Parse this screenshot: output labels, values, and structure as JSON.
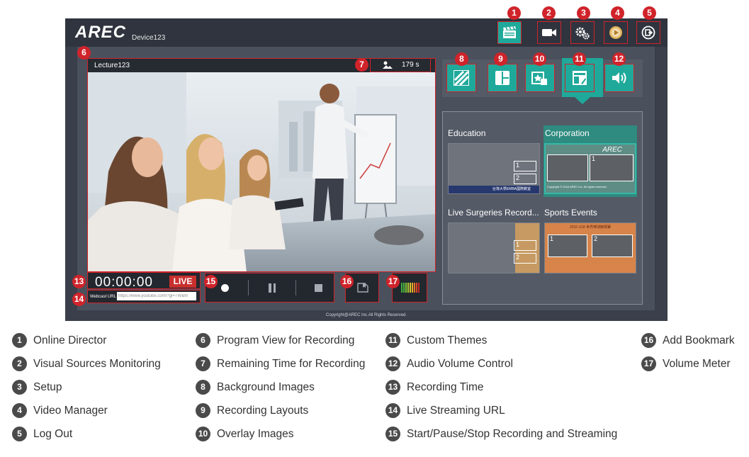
{
  "app": {
    "logo_text": "AREC",
    "device_name": "Device123",
    "scene_name": "Lecture123",
    "remaining_time": "179 s",
    "recording_time": "00:00:00",
    "live_badge": "LIVE",
    "webcast_label": "Webcast URL",
    "webcast_url": "https://www.youtube.com/?gl=TW&hl",
    "copyright": "Copyright@AREC Inc.All Rights Reserved."
  },
  "top_buttons": [
    {
      "badge": "1",
      "icon": "clapperboard-icon",
      "active": true
    },
    {
      "badge": "2",
      "icon": "video-camera-icon"
    },
    {
      "badge": "3",
      "icon": "gears-icon"
    },
    {
      "badge": "4",
      "icon": "video-manager-icon"
    },
    {
      "badge": "5",
      "icon": "logout-icon"
    }
  ],
  "tabs": [
    {
      "badge": "8",
      "icon": "background-stripes-icon"
    },
    {
      "badge": "9",
      "icon": "layout-grid-icon"
    },
    {
      "badge": "10",
      "icon": "overlay-image-icon"
    },
    {
      "badge": "11",
      "icon": "theme-icon",
      "active": true
    },
    {
      "badge": "12",
      "icon": "speaker-icon"
    }
  ],
  "themes": [
    {
      "title": "Education",
      "footer": "台灣大學EMBA國際教室",
      "box1": "1",
      "box2": "2"
    },
    {
      "title": "Corporation",
      "brand": "AREC",
      "footer": "Copyright © 2016 AREC Inc. All rights reserved.",
      "box1": "1",
      "box2": "",
      "selected": true
    },
    {
      "title": "Live Surgeries Record...",
      "box1": "1",
      "box2": "2"
    },
    {
      "title": "Sports Events",
      "header": "2016 U18 世界棒球錦標賽",
      "box1": "1",
      "box2": "2"
    }
  ],
  "callouts": {
    "program_view": "6",
    "remaining": "7",
    "recording_time": "13",
    "streaming_url": "14",
    "controls": "15",
    "bookmark": "16",
    "volume_meter": "17"
  },
  "legend": [
    {
      "num": "1",
      "label": "Online Director"
    },
    {
      "num": "2",
      "label": "Visual Sources Monitoring"
    },
    {
      "num": "3",
      "label": "Setup"
    },
    {
      "num": "4",
      "label": "Video Manager"
    },
    {
      "num": "5",
      "label": "Log Out"
    },
    {
      "num": "6",
      "label": "Program View for Recording"
    },
    {
      "num": "7",
      "label": "Remaining Time for Recording"
    },
    {
      "num": "8",
      "label": "Background Images"
    },
    {
      "num": "9",
      "label": "Recording Layouts"
    },
    {
      "num": "10",
      "label": "Overlay Images"
    },
    {
      "num": "11",
      "label": "Custom Themes"
    },
    {
      "num": "12",
      "label": "Audio Volume Control"
    },
    {
      "num": "13",
      "label": "Recording Time"
    },
    {
      "num": "14",
      "label": "Live Streaming URL"
    },
    {
      "num": "15",
      "label": "Start/Pause/Stop Recording and Streaming"
    },
    {
      "num": "16",
      "label": "Add Bookmark"
    },
    {
      "num": "17",
      "label": "Volume Meter"
    }
  ],
  "colors": {
    "teal": "#1fa99a",
    "highlight_red": "#d0232a",
    "live_red": "#c8302e",
    "app_bg": "#3a3f4b"
  }
}
